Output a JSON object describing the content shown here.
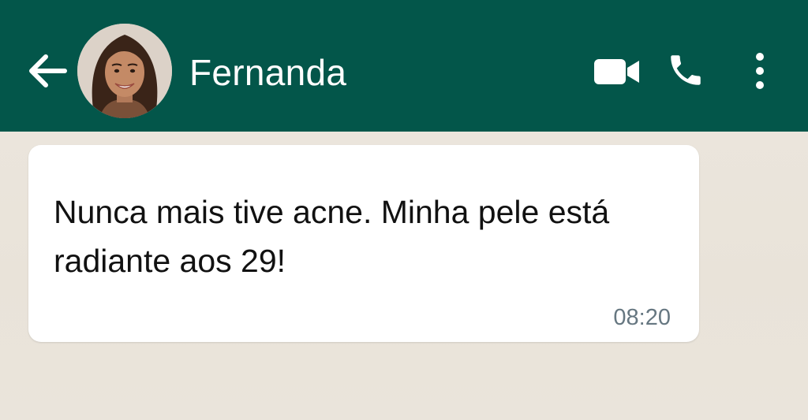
{
  "header": {
    "contact_name": "Fernanda",
    "background_color": "#03564a",
    "icons": {
      "back": "arrow-left-icon",
      "video": "video-camera-icon",
      "call": "phone-icon",
      "more": "more-vertical-icon"
    }
  },
  "message": {
    "text": "Nunca mais tive acne. Minha pele está radiante aos 29!",
    "time": "08:20"
  },
  "colors": {
    "chat_background": "#ece6dd",
    "bubble": "#ffffff",
    "timestamp": "#667781"
  }
}
